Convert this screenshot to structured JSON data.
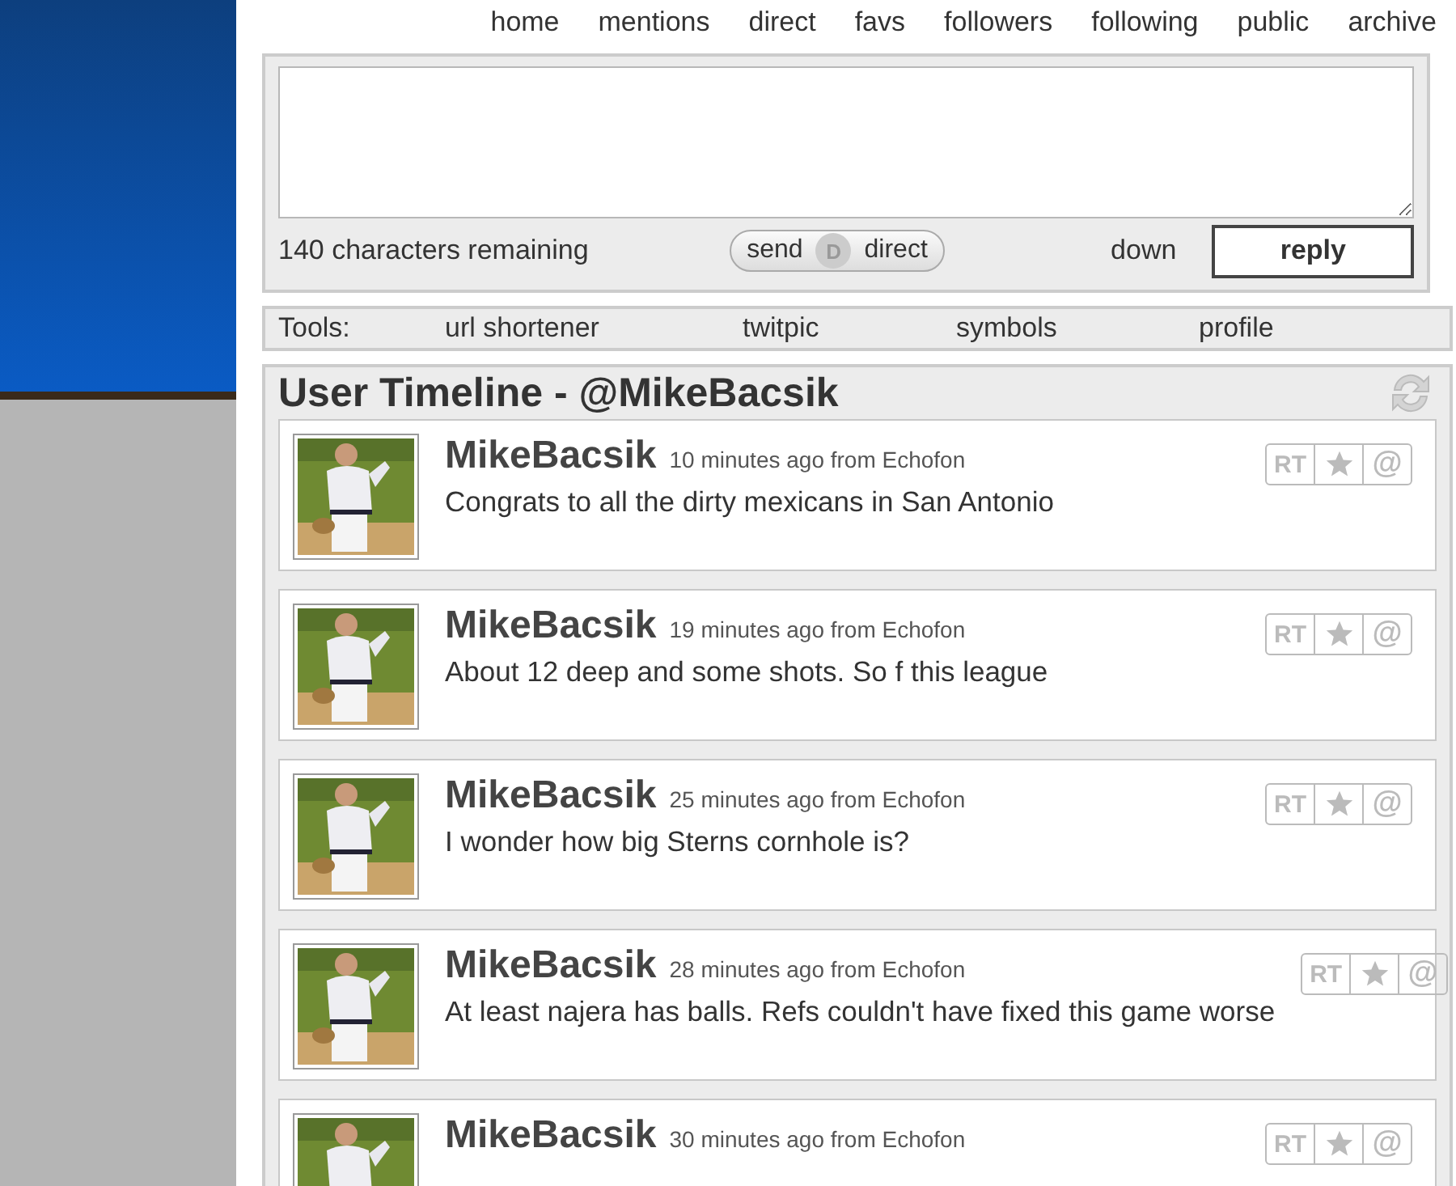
{
  "nav": [
    "home",
    "mentions",
    "direct",
    "favs",
    "followers",
    "following",
    "public",
    "archive"
  ],
  "composer": {
    "counter": "140 characters remaining",
    "toggle": {
      "left": "send",
      "badge": "D",
      "right": "direct"
    },
    "buttons": [
      {
        "label": "down",
        "kind": "plain"
      },
      {
        "label": "reply",
        "kind": "boxed"
      }
    ]
  },
  "tools": {
    "label": "Tools:",
    "items": [
      "url shortener",
      "twitpic",
      "symbols",
      "profile"
    ]
  },
  "timeline": {
    "title": "User Timeline - @MikeBacsik",
    "tweets": [
      {
        "user": "MikeBacsik",
        "meta": "10 minutes ago from Echofon",
        "text": "Congrats to all the dirty mexicans in San Antonio",
        "retweet": "RT",
        "mention": "@"
      },
      {
        "user": "MikeBacsik",
        "meta": "19 minutes ago from Echofon",
        "text": "About 12 deep and some shots. So f this league",
        "retweet": "RT",
        "mention": "@"
      },
      {
        "user": "MikeBacsik",
        "meta": "25 minutes ago from Echofon",
        "text": "I wonder how big Sterns cornhole is?",
        "retweet": "RT",
        "mention": "@"
      },
      {
        "user": "MikeBacsik",
        "meta": "28 minutes ago from Echofon",
        "text": "At least najera has balls. Refs couldn't have fixed this game worse",
        "retweet": "RT",
        "mention": "@"
      },
      {
        "user": "MikeBacsik",
        "meta": "30 minutes ago from Echofon",
        "retweet": "RT",
        "mention": "@"
      }
    ]
  }
}
